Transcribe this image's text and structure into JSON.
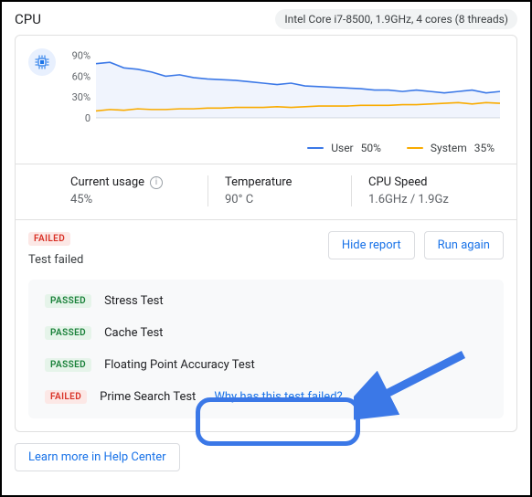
{
  "header": {
    "title": "CPU",
    "spec": "Intel Core i7-8500, 1.9GHz, 4 cores (8 threads)"
  },
  "chart_data": {
    "type": "line",
    "ylabel": "%",
    "ylim": [
      0,
      100
    ],
    "yticks": [
      "0",
      "30%",
      "60%",
      "90%"
    ],
    "x": [
      0,
      1,
      2,
      3,
      4,
      5,
      6,
      7,
      8,
      9,
      10,
      11,
      12,
      13,
      14,
      15,
      16,
      17,
      18,
      19,
      20,
      21,
      22,
      23,
      24,
      25,
      26,
      27,
      28,
      29
    ],
    "series": [
      {
        "name": "User",
        "color": "#3b78e7",
        "legend_value": "50%",
        "values": [
          78,
          80,
          72,
          70,
          66,
          60,
          62,
          58,
          56,
          55,
          54,
          52,
          50,
          48,
          50,
          46,
          45,
          44,
          43,
          42,
          40,
          40,
          38,
          40,
          38,
          36,
          38,
          40,
          36,
          38
        ]
      },
      {
        "name": "System",
        "color": "#f9ab00",
        "legend_value": "35%",
        "values": [
          10,
          12,
          11,
          13,
          12,
          12,
          13,
          13,
          14,
          14,
          15,
          15,
          15,
          16,
          15,
          16,
          17,
          17,
          17,
          18,
          18,
          18,
          19,
          19,
          20,
          21,
          22,
          20,
          22,
          21
        ]
      }
    ]
  },
  "legend": {
    "user": {
      "label": "User",
      "value": "50%"
    },
    "system": {
      "label": "System",
      "value": "35%"
    }
  },
  "stats": {
    "usage": {
      "label": "Current usage",
      "value": "45%"
    },
    "temp": {
      "label": "Temperature",
      "value": "90° C"
    },
    "speed": {
      "label": "CPU Speed",
      "value": "1.6GHz / 1.9Gz"
    }
  },
  "report": {
    "status_badge": "FAILED",
    "message": "Test failed",
    "hide_btn": "Hide report",
    "run_btn": "Run again",
    "why_link": "Why has this test failed?",
    "tests": [
      {
        "status": "PASSED",
        "name": "Stress Test"
      },
      {
        "status": "PASSED",
        "name": "Cache Test"
      },
      {
        "status": "PASSED",
        "name": "Floating Point Accuracy Test"
      },
      {
        "status": "FAILED",
        "name": "Prime Search Test"
      }
    ]
  },
  "footer": {
    "learn_more": "Learn more in Help Center"
  },
  "colors": {
    "user": "#3b78e7",
    "system": "#f9ab00"
  }
}
